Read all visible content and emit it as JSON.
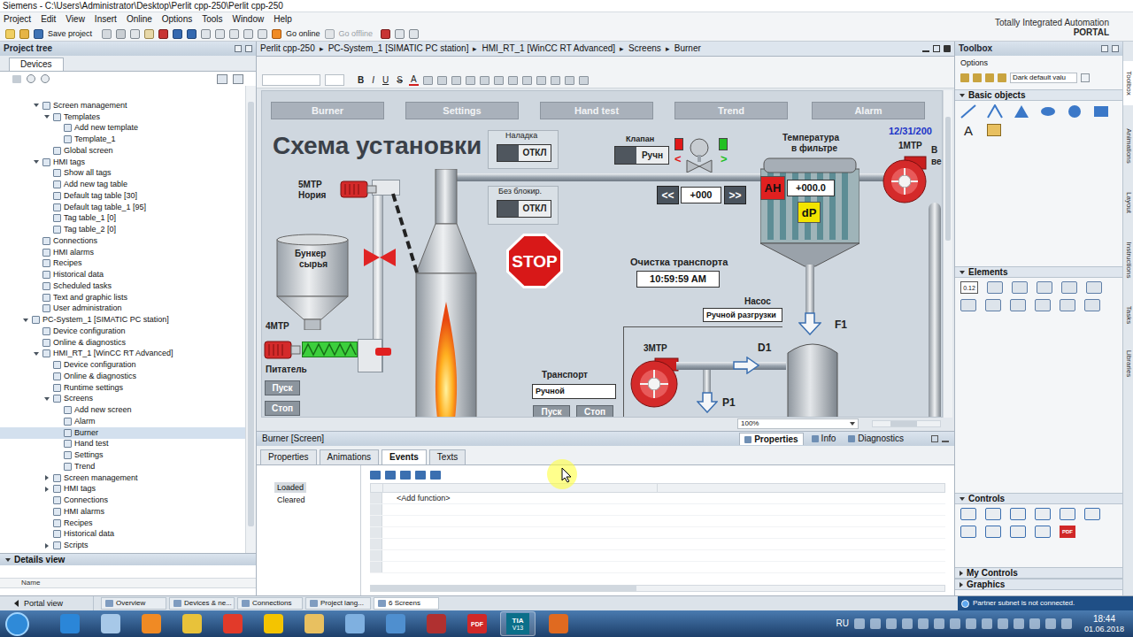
{
  "window": {
    "title": "Siemens - C:\\Users\\Administrator\\Desktop\\Perlit cpp-250\\Perlit cpp-250"
  },
  "menu": [
    "Project",
    "Edit",
    "View",
    "Insert",
    "Online",
    "Options",
    "Tools",
    "Window",
    "Help"
  ],
  "brand": {
    "line1": "Totally Integrated Automation",
    "line2": "PORTAL"
  },
  "toolbar": {
    "save": "Save project",
    "go_online": {
      "label": "Go online",
      "disabled": false
    },
    "go_offline": {
      "label": "Go offline",
      "disabled": true
    }
  },
  "project_tree": {
    "title": "Project tree",
    "tab": "Devices",
    "items": [
      {
        "label": "Screen management",
        "level": 2,
        "expanded": true,
        "selected": false
      },
      {
        "label": "Templates",
        "level": 3,
        "expanded": true,
        "selected": false
      },
      {
        "label": "Add new template",
        "level": 4,
        "selected": false
      },
      {
        "label": "Template_1",
        "level": 4,
        "selected": false
      },
      {
        "label": "Global screen",
        "level": 3,
        "selected": false
      },
      {
        "label": "HMI tags",
        "level": 2,
        "expanded": true,
        "selected": false
      },
      {
        "label": "Show all tags",
        "level": 3,
        "selected": false
      },
      {
        "label": "Add new tag table",
        "level": 3,
        "selected": false
      },
      {
        "label": "Default tag table [30]",
        "level": 3,
        "selected": false
      },
      {
        "label": "Default tag table_1 [95]",
        "level": 3,
        "selected": false
      },
      {
        "label": "Tag table_1 [0]",
        "level": 3,
        "selected": false
      },
      {
        "label": "Tag table_2 [0]",
        "level": 3,
        "selected": false
      },
      {
        "label": "Connections",
        "level": 2,
        "selected": false
      },
      {
        "label": "HMI alarms",
        "level": 2,
        "selected": false
      },
      {
        "label": "Recipes",
        "level": 2,
        "selected": false
      },
      {
        "label": "Historical data",
        "level": 2,
        "selected": false
      },
      {
        "label": "Scheduled tasks",
        "level": 2,
        "selected": false
      },
      {
        "label": "Text and graphic lists",
        "level": 2,
        "selected": false
      },
      {
        "label": "User administration",
        "level": 2,
        "selected": false
      },
      {
        "label": "PC-System_1 [SIMATIC PC station]",
        "level": 1,
        "expanded": true,
        "selected": false
      },
      {
        "label": "Device configuration",
        "level": 2,
        "selected": false
      },
      {
        "label": "Online & diagnostics",
        "level": 2,
        "selected": false
      },
      {
        "label": "HMI_RT_1 [WinCC RT Advanced]",
        "level": 2,
        "expanded": true,
        "selected": false
      },
      {
        "label": "Device configuration",
        "level": 3,
        "selected": false
      },
      {
        "label": "Online & diagnostics",
        "level": 3,
        "selected": false
      },
      {
        "label": "Runtime settings",
        "level": 3,
        "selected": false
      },
      {
        "label": "Screens",
        "level": 3,
        "expanded": true,
        "selected": false
      },
      {
        "label": "Add new screen",
        "level": 4,
        "selected": false
      },
      {
        "label": "Alarm",
        "level": 4,
        "selected": false
      },
      {
        "label": "Burner",
        "level": 4,
        "selected": true
      },
      {
        "label": "Hand test",
        "level": 4,
        "selected": false
      },
      {
        "label": "Settings",
        "level": 4,
        "selected": false
      },
      {
        "label": "Trend",
        "level": 4,
        "selected": false
      },
      {
        "label": "Screen management",
        "level": 3,
        "expanded": false,
        "selected": false
      },
      {
        "label": "HMI tags",
        "level": 3,
        "expanded": false,
        "selected": false
      },
      {
        "label": "Connections",
        "level": 3,
        "selected": false
      },
      {
        "label": "HMI alarms",
        "level": 3,
        "selected": false
      },
      {
        "label": "Recipes",
        "level": 3,
        "selected": false
      },
      {
        "label": "Historical data",
        "level": 3,
        "selected": false
      },
      {
        "label": "Scripts",
        "level": 3,
        "expanded": false,
        "selected": false
      }
    ]
  },
  "details_view": {
    "title": "Details view",
    "column": "Name"
  },
  "editor": {
    "breadcrumb": [
      "Perlit cpp-250",
      "PC-System_1 [SIMATIC PC station]",
      "HMI_RT_1 [WinCC RT Advanced]",
      "Screens",
      "Burner"
    ],
    "separator": "▸",
    "format_buttons": [
      {
        "label": "B",
        "kind": "bold"
      },
      {
        "label": "I",
        "kind": "italic"
      },
      {
        "label": "U",
        "kind": "underline"
      },
      {
        "label": "S",
        "kind": "strike"
      },
      {
        "label": "A",
        "kind": "color"
      }
    ],
    "zoom": "100%"
  },
  "hmi_screen": {
    "nav": [
      "Burner",
      "Settings",
      "Hand test",
      "Trend",
      "Alarm"
    ],
    "date": "12/31/200",
    "title": "Схема установки",
    "labels": [
      "Наладка",
      "Без блокир.",
      "Клапан",
      "Температура",
      "в фильтре",
      "1МТР",
      "В",
      "ве",
      "5МТР",
      "Нория",
      "Бункер",
      "сырья",
      "Очистка транспорта",
      "Насос",
      "4МТР",
      "Питатель",
      "Транспорт",
      "3МТР",
      "D1",
      "F1",
      "P1"
    ],
    "toggles": [
      {
        "label": "ОТКЛ",
        "on": false
      },
      {
        "label": "ОТКЛ",
        "on": false
      },
      {
        "label": "Ручн",
        "on": false
      }
    ],
    "buttons": [
      {
        "label": "<<",
        "kind": "step"
      },
      {
        "label": ">>",
        "kind": "step"
      },
      {
        "label": "Пуск",
        "kind": "command"
      },
      {
        "label": "Стоп",
        "kind": "command"
      },
      {
        "label": "Пуск",
        "kind": "command"
      },
      {
        "label": "Стоп",
        "kind": "command"
      }
    ],
    "fields": [
      "+000",
      "+000.0",
      "10:59:59 AM",
      "Ручной разгрузки",
      "Ручной"
    ],
    "indicators": [
      {
        "label": "AH",
        "color": "#e02020"
      },
      {
        "label": "dP",
        "color": "#f2e400"
      }
    ],
    "stop_sign": "STOP",
    "valve_lamps": [
      {
        "color": "#e01818"
      },
      {
        "color": "#22c022"
      }
    ],
    "valve_arrows": [
      {
        "text": "<",
        "color": "#e01818"
      },
      {
        "text": ">",
        "color": "#22c022"
      }
    ]
  },
  "properties": {
    "title": "Burner [Screen]",
    "inspector_tabs": [
      {
        "label": "Properties",
        "selected": true
      },
      {
        "label": "Info",
        "selected": false
      },
      {
        "label": "Diagnostics",
        "selected": false
      }
    ],
    "tabs": [
      {
        "label": "Properties",
        "selected": false
      },
      {
        "label": "Animations",
        "selected": false
      },
      {
        "label": "Events",
        "selected": true
      },
      {
        "label": "Texts",
        "selected": false
      }
    ],
    "events": [
      {
        "label": "Loaded",
        "selected": true
      },
      {
        "label": "Cleared",
        "selected": false
      }
    ],
    "add_function": "<Add function>"
  },
  "toolbox": {
    "title": "Toolbox",
    "options": "Options",
    "dropdown": "Dark default valu",
    "sections": [
      {
        "label": "Basic objects",
        "expanded": true
      },
      {
        "label": "Elements",
        "expanded": true
      },
      {
        "label": "Controls",
        "expanded": true
      },
      {
        "label": "My Controls",
        "expanded": false
      },
      {
        "label": "Graphics",
        "expanded": false
      }
    ],
    "text_tool": "A",
    "io_field": "0.12",
    "pdf_control": "PDF"
  },
  "side_tabs": [
    "Toolbox",
    "Animations",
    "Layout",
    "Instructions",
    "Tasks",
    "Libraries"
  ],
  "status_bar": {
    "portal_view": "Portal view",
    "tabs": [
      {
        "label": "Overview",
        "selected": false
      },
      {
        "label": "Devices & ne...",
        "selected": false
      },
      {
        "label": "Connections",
        "selected": false
      },
      {
        "label": "Project lang...",
        "selected": false
      },
      {
        "label": "6 Screens",
        "selected": true
      }
    ],
    "message": "Partner subnet is not connected."
  },
  "taskbar": {
    "pdf_label": "PDF",
    "tia_label": "TIA",
    "tia_version": "V13",
    "language": "RU",
    "time": "18:44",
    "date": "01.06.2018"
  }
}
